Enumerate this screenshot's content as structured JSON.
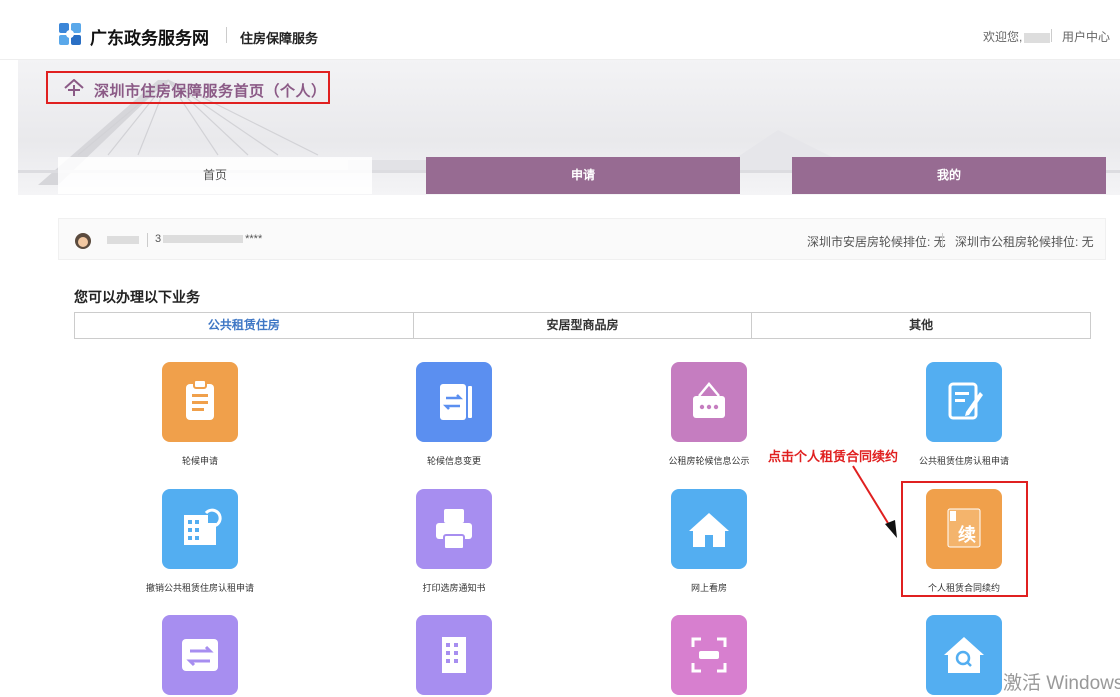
{
  "header": {
    "site_name": "广东政务服务网",
    "sub_name": "住房保障服务",
    "welcome": "欢迎您,",
    "user_center": "用户中心"
  },
  "banner": {
    "title": "深圳市住房保障服务首页（个人）"
  },
  "nav": {
    "home": "首页",
    "apply": "申请",
    "mine": "我的"
  },
  "user": {
    "id_prefix": "3",
    "id_suffix": "****",
    "queue_anju": "深圳市安居房轮候排位: 无",
    "queue_gongzu": "深圳市公租房轮候排位: 无"
  },
  "services": {
    "title": "您可以办理以下业务",
    "tabs": [
      "公共租赁住房",
      "安居型商品房",
      "其他"
    ],
    "items": [
      {
        "label": "轮候申请",
        "icon": "clipboard-icon",
        "color": "#f0a04b"
      },
      {
        "label": "轮候信息变更",
        "icon": "exchange-doc-icon",
        "color": "#5b8ff0"
      },
      {
        "label": "公租房轮候信息公示",
        "icon": "notice-board-icon",
        "color": "#c57dc0"
      },
      {
        "label": "公共租赁住房认租申请",
        "icon": "edit-doc-icon",
        "color": "#53aef1"
      },
      {
        "label": "撤销公共租赁住房认租申请",
        "icon": "building-undo-icon",
        "color": "#53aef1"
      },
      {
        "label": "打印选房通知书",
        "icon": "printer-icon",
        "color": "#a78ef0"
      },
      {
        "label": "网上看房",
        "icon": "home-icon",
        "color": "#53aef1"
      },
      {
        "label": "个人租赁合同续约",
        "icon": "renew-contract-icon",
        "color": "#f0a04b"
      },
      {
        "label": "",
        "icon": "swap-icon",
        "color": "#a78ef0"
      },
      {
        "label": "",
        "icon": "building-icon",
        "color": "#a78ef0"
      },
      {
        "label": "",
        "icon": "scan-icon",
        "color": "#d77fcf"
      },
      {
        "label": "",
        "icon": "house-search-icon",
        "color": "#53aef1"
      }
    ]
  },
  "annotation": {
    "text": "点击个人租赁合同续约",
    "color": "#e02020"
  },
  "watermark": "激活 Windows",
  "colors": {
    "nav_purple": "#976b92",
    "tab_active": "#3f77c5",
    "title_purple": "#8b5a86"
  }
}
